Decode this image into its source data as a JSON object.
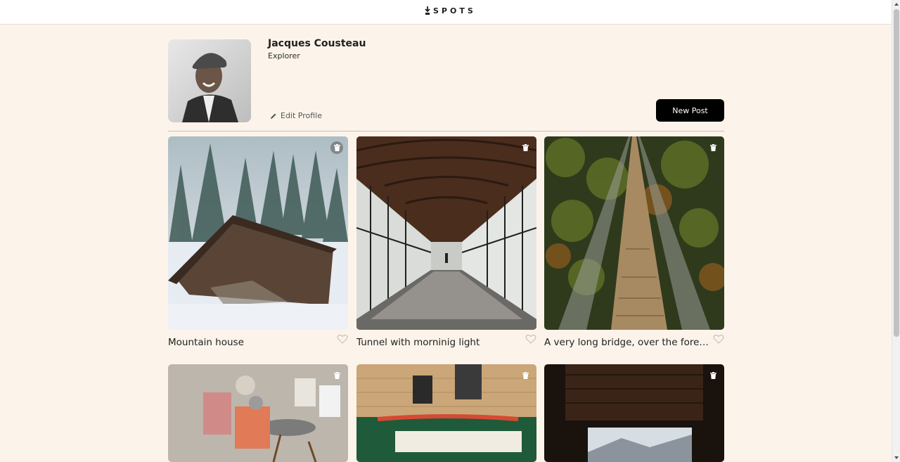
{
  "header": {
    "logo_text": "SPOTS",
    "logo_icon": "spots-logo-icon"
  },
  "profile": {
    "name": "Jacques Cousteau",
    "description": "Explorer",
    "edit_label": "Edit Profile",
    "new_post_label": "New Post"
  },
  "cards": [
    {
      "title": "Mountain house",
      "liked": false
    },
    {
      "title": "Tunnel with morninig light",
      "liked": false
    },
    {
      "title": "A very long bridge, over the forest and through the trees",
      "liked": false
    },
    {
      "title": "",
      "liked": false
    },
    {
      "title": "",
      "liked": false
    },
    {
      "title": "",
      "liked": false
    }
  ],
  "colors": {
    "background": "#fcf4ea",
    "button": "#000000",
    "text": "#212121"
  }
}
